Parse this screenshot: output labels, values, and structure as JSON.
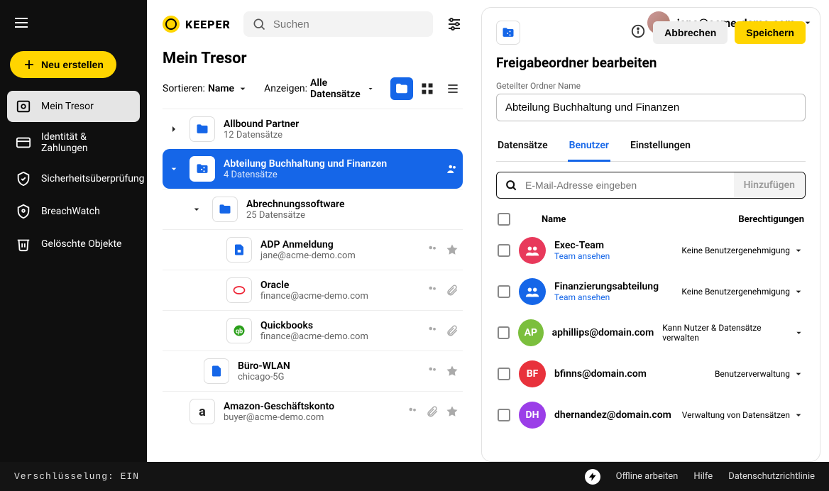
{
  "brand": "KEEPER",
  "user_email": "jane@acme-demo.com",
  "new_button": "Neu erstellen",
  "nav": {
    "vault": "Mein Tresor",
    "identity": "Identität & Zahlungen",
    "security": "Sicherheitsüberprüfung",
    "breach": "BreachWatch",
    "deleted": "Gelöschte Objekte"
  },
  "search_placeholder": "Suchen",
  "heading": "Mein Tresor",
  "sort_prefix": "Sortieren: ",
  "sort_value": "Name",
  "show_prefix": "Anzeigen: ",
  "show_value": "Alle Datensätze",
  "records": [
    {
      "title": "Allbound Partner",
      "sub": "12 Datensätze"
    },
    {
      "title": "Abteilung Buchhaltung und Finanzen",
      "sub": "4 Datensätze"
    },
    {
      "title": "Abrechnungssoftware",
      "sub": "25 Datensätze"
    },
    {
      "title": "ADP Anmeldung",
      "sub": "jane@acme-demo.com"
    },
    {
      "title": "Oracle",
      "sub": "finance@acme-demo.com"
    },
    {
      "title": "Quickbooks",
      "sub": "finance@acme-demo.com"
    },
    {
      "title": "Büro-WLAN",
      "sub": "chicago-5G"
    },
    {
      "title": "Amazon-Geschäftskonto",
      "sub": "buyer@acme-demo.com"
    }
  ],
  "panel": {
    "title": "Freigabeordner bearbeiten",
    "name_label": "Geteilter Ordner Name",
    "name_value": "Abteilung Buchhaltung und Finanzen",
    "cancel": "Abbrechen",
    "save": "Speichern",
    "tabs": {
      "records": "Datensätze",
      "users": "Benutzer",
      "settings": "Einstellungen"
    },
    "email_placeholder": "E-Mail-Adresse eingeben",
    "add": "Hinzufügen",
    "col_name": "Name",
    "col_perm": "Berechtigungen",
    "team_link": "Team ansehen",
    "users": [
      {
        "name": "Exec-Team",
        "perm": "Keine Benutzergenehmigung",
        "avatar": "team",
        "color": "#e8395b"
      },
      {
        "name": "Finanzierungsabteilung",
        "perm": "Keine Benutzergenehmigung",
        "avatar": "team",
        "color": "#1566e8"
      },
      {
        "name": "aphillips@domain.com",
        "perm": "Kann Nutzer & Datensätze verwalten",
        "avatar": "AP",
        "color": "#7bbf3d"
      },
      {
        "name": "bfinns@domain.com",
        "perm": "Benutzerverwaltung",
        "avatar": "BF",
        "color": "#e8323c"
      },
      {
        "name": "dhernandez@domain.com",
        "perm": "Verwaltung von Datensätzen",
        "avatar": "DH",
        "color": "#9b3ee8"
      }
    ]
  },
  "footer": {
    "encryption": "Verschlüsselung: EIN",
    "offline": "Offline arbeiten",
    "help": "Hilfe",
    "privacy": "Datenschutzrichtlinie"
  }
}
